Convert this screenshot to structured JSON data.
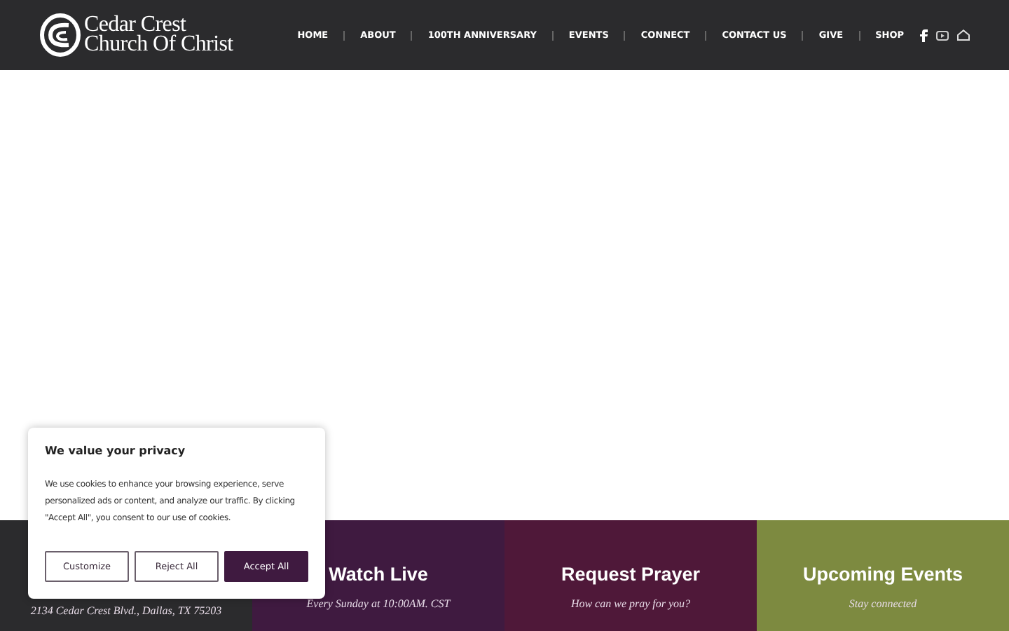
{
  "header": {
    "logo_line_1": "Cedar Crest",
    "logo_line_2": "Church Of Christ",
    "nav": [
      "HOME",
      "ABOUT",
      "100TH ANNIVERSARY",
      "EVENTS",
      "CONNECT",
      "CONTACT US",
      "GIVE",
      "SHOP"
    ]
  },
  "panels": [
    {
      "subtitle": "2134 Cedar Crest Blvd., Dallas, TX 75203",
      "color": "#2b2b2d"
    },
    {
      "title": "Watch Live",
      "subtitle": "Every Sunday at 10:00AM. CST",
      "color": "#3f1a40"
    },
    {
      "title": "Request Prayer",
      "subtitle": "How can we pray for you?",
      "color": "#4f1839"
    },
    {
      "title": "Upcoming Events",
      "subtitle": "Stay connected",
      "color": "#7d8a40"
    }
  ],
  "cookie_banner": {
    "title": "We value your privacy",
    "text": "We use cookies to enhance your browsing experience, serve personalized ads or content, and analyze our traffic. By clicking \"Accept All\", you consent to our use of cookies.",
    "buttons": [
      {
        "label": "Customize",
        "kind": "outline"
      },
      {
        "label": "Reject All",
        "kind": "outline"
      },
      {
        "label": "Accept All",
        "kind": "filled"
      }
    ]
  }
}
